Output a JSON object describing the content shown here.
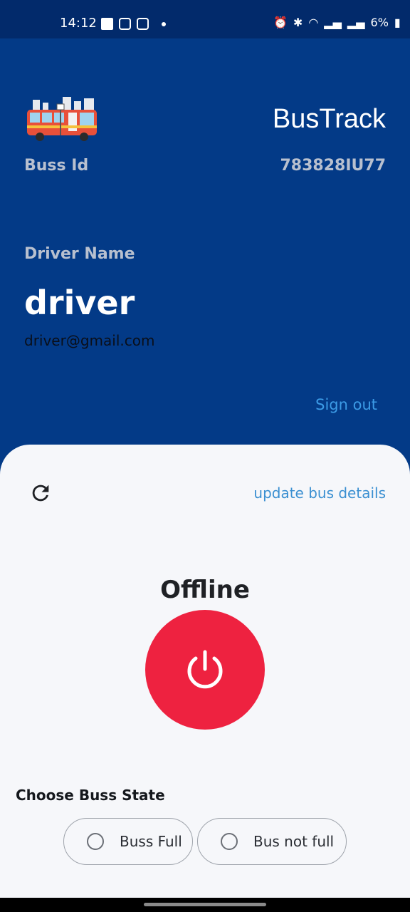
{
  "status_bar": {
    "time": "14:12",
    "battery": "6%"
  },
  "header": {
    "app_title": "BusTrack",
    "bus_id_label": "Buss Id",
    "bus_id_value": "783828IU77",
    "driver_label": "Driver Name",
    "driver_name": "driver",
    "driver_email": "driver@gmail.com",
    "sign_out_label": "Sign out"
  },
  "controls": {
    "update_label": "update bus details",
    "status_text": "Offline"
  },
  "bus_state": {
    "title": "Choose Buss State",
    "options": [
      {
        "label": "Buss Full",
        "selected": false
      },
      {
        "label": "Bus not full",
        "selected": false
      }
    ]
  },
  "colors": {
    "header_bg": "#033a87",
    "status_bar_bg": "#022a6b",
    "power_button": "#ee2240",
    "link": "#3a8fd1"
  }
}
